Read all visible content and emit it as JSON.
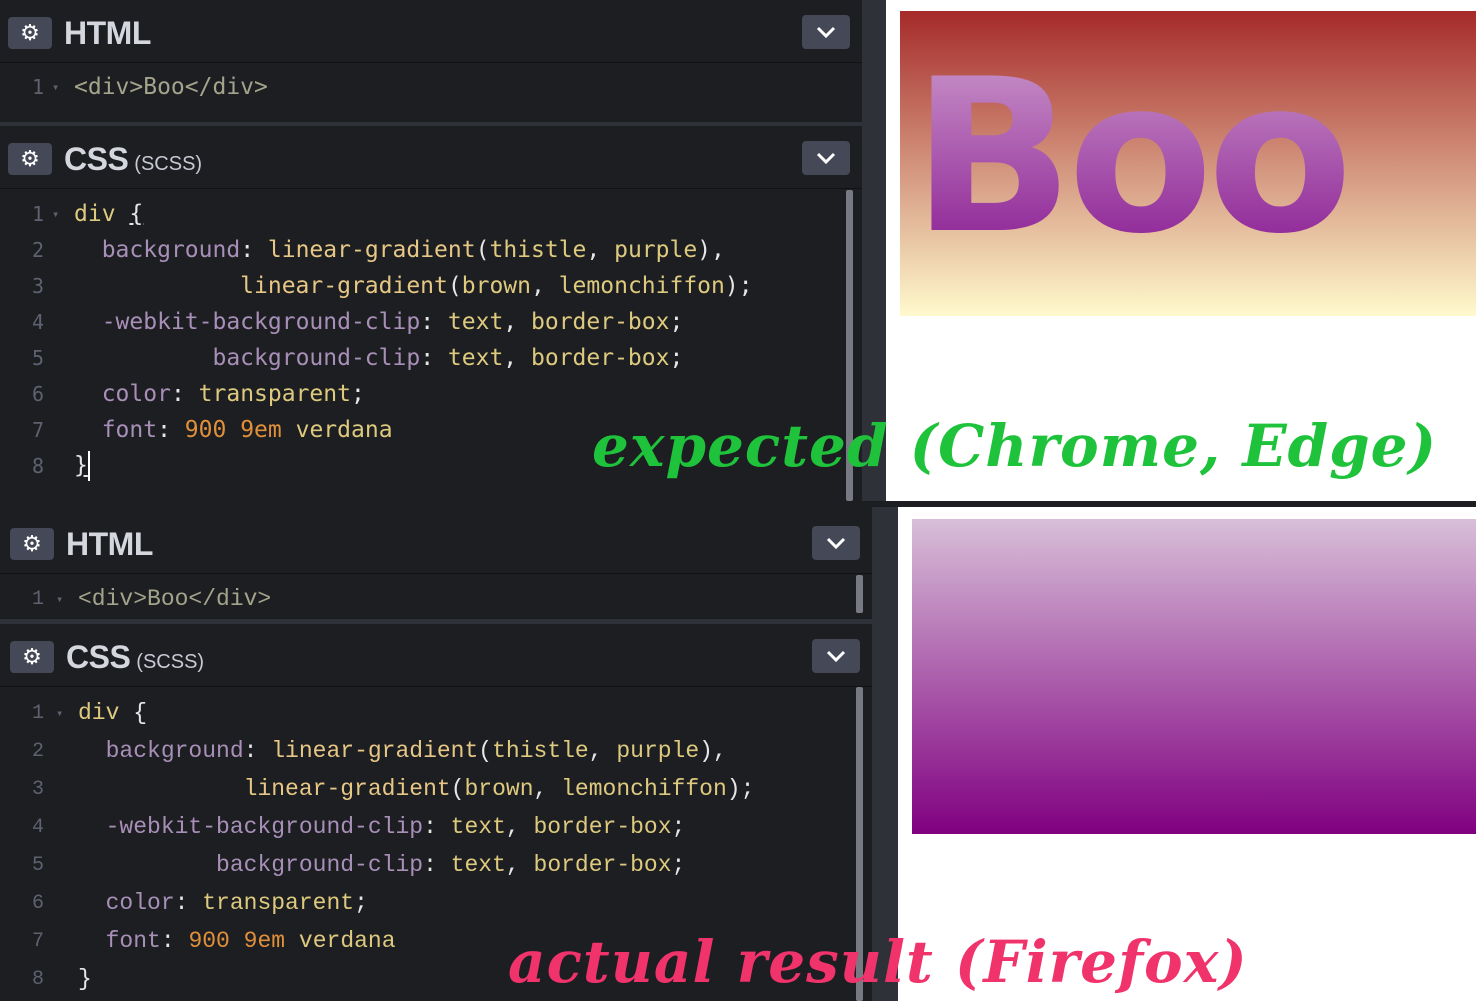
{
  "top": {
    "html_panel": {
      "title": "HTML",
      "code": [
        "<div>Boo</div>"
      ]
    },
    "css_panel": {
      "title": "CSS",
      "subtitle": "(SCSS)"
    },
    "preview": {
      "text": "Boo"
    },
    "annotation": "expected (Chrome, Edge)"
  },
  "bottom": {
    "html_panel": {
      "title": "HTML",
      "code": [
        "<div>Boo</div>"
      ]
    },
    "css_panel": {
      "title": "CSS",
      "subtitle": "(SCSS)"
    },
    "annotation": "actual result (Firefox)"
  },
  "css_code": {
    "l1_sel": "div",
    "l1_brace": "{",
    "l2_prop": "background",
    "l2_fn": "linear-gradient",
    "l2_args_a": "thistle",
    "l2_args_b": "purple",
    "l3_fn": "linear-gradient",
    "l3_args_a": "brown",
    "l3_args_b": "lemonchiffon",
    "l4_prop": "-webkit-background-clip",
    "l4_v1": "text",
    "l4_v2": "border-box",
    "l5_prop": "background-clip",
    "l5_v1": "text",
    "l5_v2": "border-box",
    "l6_prop": "color",
    "l6_v": "transparent",
    "l7_prop": "font",
    "l7_n1": "900",
    "l7_n2": "9em",
    "l7_v": "verdana",
    "l8_brace": "}"
  },
  "line_numbers": [
    "1",
    "2",
    "3",
    "4",
    "5",
    "6",
    "7",
    "8"
  ],
  "icons": {
    "gear": "gear-icon",
    "chevron": "chevron-down-icon"
  },
  "colors": {
    "editor_bg": "#1d1e22",
    "header_button": "#444857",
    "expected_annotation": "#1fc23b",
    "actual_annotation": "#f0336b",
    "gradient_text": [
      "thistle",
      "purple"
    ],
    "gradient_box": [
      "brown",
      "lemonchiffon"
    ]
  }
}
